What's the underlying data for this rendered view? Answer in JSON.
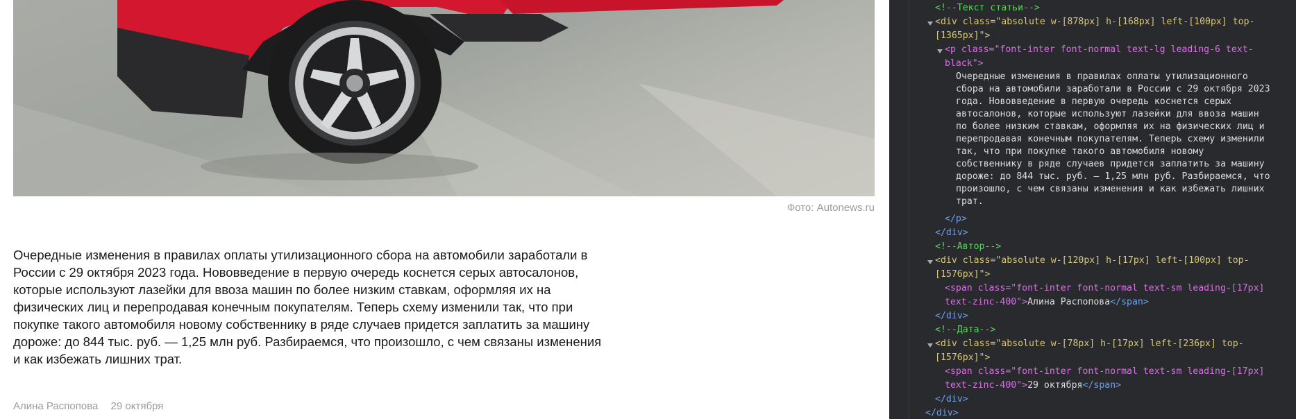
{
  "article": {
    "photo_caption": "Фото: Autonews.ru",
    "body_lines": [
      "Очередные изменения в правилах оплаты утилизационного сбора на автомобили заработали в",
      "России с 29 октября 2023 года. Нововведение в первую очередь коснется серых автосалонов,",
      "которые используют лазейки для ввоза машин по более низким ставкам, оформляя их на",
      "физических лиц и перепродавая конечным покупателям. Теперь схему изменили так, что при",
      "покупке такого автомобиля новому собственнику в ряде случаев придется заплатить за машину",
      "дороже: до 844 тыс. руб. — 1,25 млн руб. Разбираемся, что произошло, с чем связаны изменения",
      "и как избежать лишних трат."
    ],
    "author": "Алина Распопова",
    "date": "29 октября"
  },
  "devtools": {
    "comment_text": "<!--Текст статьи-->",
    "div1_open_1": "<div class=\"absolute w-[878px] h-[168px] left-[100px] top-",
    "div1_open_2": "[1365px]\">",
    "p_open_1": "<p class=\"font-inter font-normal text-lg leading-6 text-",
    "p_open_2": "black\">",
    "p_text": [
      "Очередные изменения в правилах оплаты утилизационного",
      "сбора на автомобили заработали в России с 29 октября 2023",
      "года. Нововведение в первую очередь коснется серых",
      "автосалонов, которые используют лазейки для ввоза машин",
      "по более низким ставкам, оформляя их на физических лиц и",
      "перепродавая конечным покупателям. Теперь схему изменили",
      "так, что при покупке такого автомобиля новому",
      "собственнику в ряде случаев придется заплатить за машину",
      "дороже: до 844 тыс. руб. — 1,25 млн руб. Разбираемся, что",
      "произошло, с чем связаны изменения и как избежать лишних",
      "трат."
    ],
    "p_close": "</p>",
    "div_close": "</div>",
    "comment_author": "<!--Автор-->",
    "div2_open_1": "<div class=\"absolute w-[120px] h-[17px] left-[100px] top-",
    "div2_open_2": "[1576px]\">",
    "span1_1": "<span class=\"font-inter font-normal text-sm leading-[17px]",
    "span1_2_pre": "text-zinc-400\">",
    "span1_text": "Алина Распопова",
    "span_close": "</span>",
    "comment_date": "<!--Дата-->",
    "div3_open_1": "<div class=\"absolute w-[78px] h-[17px] left-[236px] top-",
    "div3_open_2": "[1576px]\">",
    "span2_1": "<span class=\"font-inter font-normal text-sm leading-[17px]",
    "span2_2_pre": "text-zinc-400\">",
    "span2_text": "29 октября",
    "outer_div_close": "</div>"
  }
}
